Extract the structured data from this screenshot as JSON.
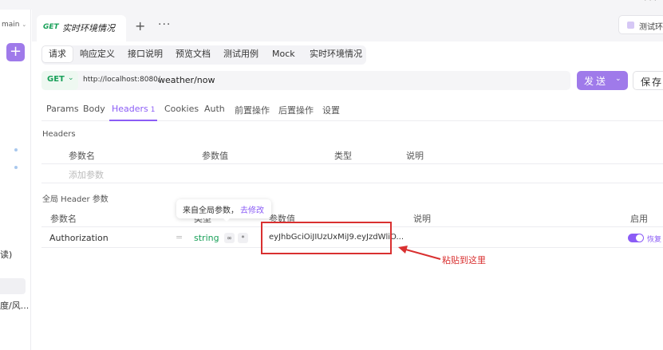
{
  "sidebar": {
    "project_label": "main",
    "add_label": "+",
    "snippets": [
      "读)",
      "度/风..."
    ]
  },
  "tabs": {
    "active_method": "GET",
    "active_title": "实时环境情况",
    "add_label": "+",
    "more_label": "···",
    "env_label": "测试环"
  },
  "subtabs": [
    "请求",
    "响应定义",
    "接口说明",
    "预览文档",
    "测试用例",
    "Mock",
    "实时环境情况"
  ],
  "request": {
    "method": "GET",
    "base_url": "http://localhost:8080/",
    "path": "weather/now",
    "send_label": "发送",
    "save_label": "保存"
  },
  "request_tabs": [
    {
      "label": "Params"
    },
    {
      "label": "Body"
    },
    {
      "label": "Headers",
      "badge": "1"
    },
    {
      "label": "Cookies"
    },
    {
      "label": "Auth"
    },
    {
      "label": "前置操作"
    },
    {
      "label": "后置操作"
    },
    {
      "label": "设置"
    }
  ],
  "headers_section": {
    "title": "Headers",
    "columns": {
      "name": "参数名",
      "value": "参数值",
      "type": "类型",
      "desc": "说明"
    },
    "add_placeholder": "添加参数"
  },
  "global_section": {
    "title": "全局 Header 参数",
    "columns": {
      "name": "参数名",
      "type": "类型",
      "value": "参数值",
      "desc": "说明",
      "enabled": "启用"
    },
    "row": {
      "name": "Authorization",
      "equals": "=",
      "type": "string",
      "value": "eyJhbGciOiJIUzUxMiJ9.eyJzdWliO...",
      "restore_label": "恢复"
    }
  },
  "tooltip": {
    "text": "来自全局参数，",
    "link": "去修改"
  },
  "annotation": {
    "text": "粘贴到这里",
    "color": "#d93030"
  },
  "colors": {
    "accent": "#8b5cf6",
    "get_green": "#18a058"
  }
}
